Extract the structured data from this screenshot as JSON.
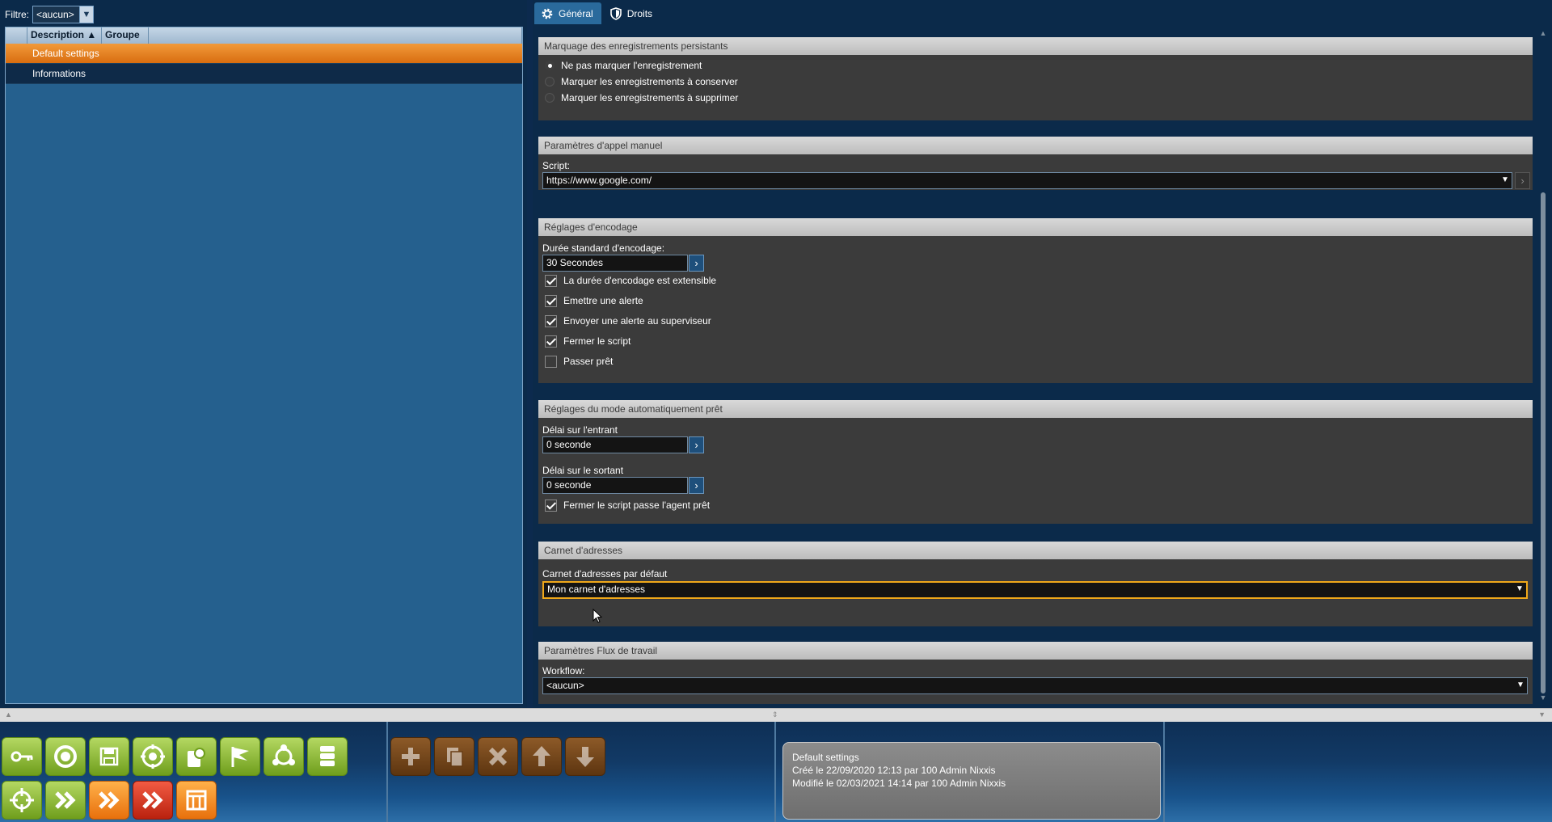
{
  "left": {
    "filter_label": "Filtre:",
    "filter_value": "<aucun>",
    "columns": [
      "",
      "Description ▲",
      "Groupe"
    ],
    "rows": [
      "Default settings",
      "Informations"
    ]
  },
  "tabs": [
    {
      "label": "Général",
      "icon": "gear-icon",
      "active": true
    },
    {
      "label": "Droits",
      "icon": "shield-icon",
      "active": false
    }
  ],
  "sections": {
    "marquage": {
      "title": "Marquage des enregistrements persistants",
      "options": [
        "Ne pas marquer l'enregistrement",
        "Marquer les enregistrements à conserver",
        "Marquer les enregistrements à supprimer"
      ],
      "selected": 0
    },
    "appel": {
      "title": "Paramètres d'appel manuel",
      "script_label": "Script:",
      "script_value": "https://www.google.com/"
    },
    "encodage": {
      "title": "Réglages d'encodage",
      "duree_label": "Durée standard d'encodage:",
      "duree_value": "30 Secondes",
      "checks": [
        {
          "label": "La durée d'encodage est extensible",
          "checked": true
        },
        {
          "label": "Emettre une alerte",
          "checked": true
        },
        {
          "label": "Envoyer une alerte au superviseur",
          "checked": true
        },
        {
          "label": "Fermer le script",
          "checked": true
        },
        {
          "label": "Passer prêt",
          "checked": false
        }
      ]
    },
    "auto": {
      "title": "Réglages du mode automatiquement prêt",
      "entrant_label": "Délai sur l'entrant",
      "entrant_value": "0 seconde",
      "sortant_label": "Délai sur le sortant",
      "sortant_value": "0 seconde",
      "check_label": "Fermer le script passe l'agent prêt",
      "check_checked": true
    },
    "carnet": {
      "title": "Carnet d'adresses",
      "label": "Carnet d'adresses par défaut",
      "value": "Mon carnet d'adresses"
    },
    "flux": {
      "title": "Paramètres Flux de travail",
      "label": "Workflow:",
      "value": "<aucun>"
    }
  },
  "info": {
    "title": "Default settings",
    "created": "Créé le 22/09/2020 12:13 par 100 Admin Nixxis",
    "modified": "Modifié le 02/03/2021 14:14 par 100 Admin Nixxis"
  },
  "toolbar": {
    "row1": [
      "key-icon",
      "refresh-icon",
      "save-icon",
      "target-headset-icon",
      "contact-icon",
      "flag-icon",
      "team-icon",
      "database-icon"
    ],
    "row2": [
      "crosshair-icon",
      "forward-green-icon",
      "forward-orange-icon",
      "forward-red-icon",
      "table-icon"
    ],
    "edit": [
      "add-icon",
      "copy-icon",
      "delete-icon",
      "move-up-icon",
      "move-down-icon"
    ]
  },
  "colors": {
    "accent_orange": "#e8700c",
    "accent_green": "#6f9e1c",
    "selected_row": "#e9841f",
    "focus_border": "#f0a81a"
  }
}
